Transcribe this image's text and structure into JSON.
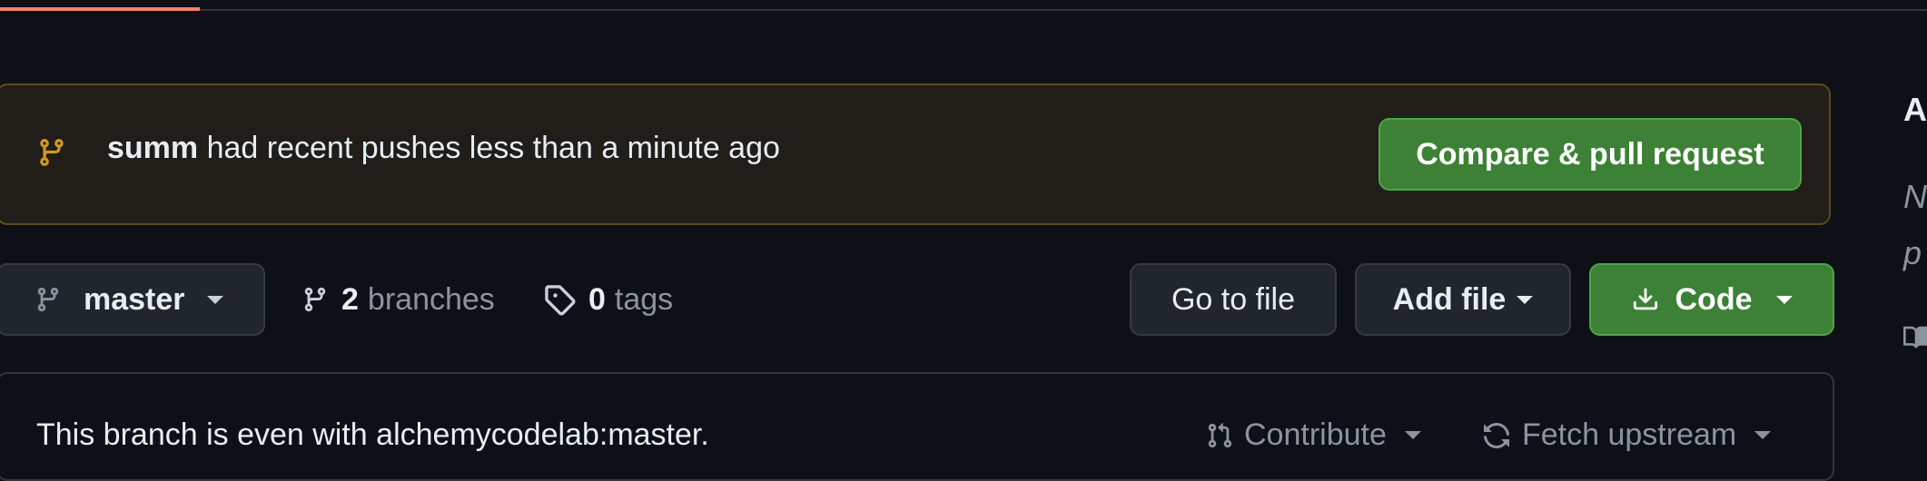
{
  "banner": {
    "branch_name": "summ",
    "message": "had recent pushes less than a minute ago",
    "compare_button": "Compare & pull request"
  },
  "toolbar": {
    "branch_selector": "master",
    "branches_count": "2",
    "branches_label": "branches",
    "tags_count": "0",
    "tags_label": "tags",
    "go_to_file": "Go to file",
    "add_file": "Add file",
    "code": "Code"
  },
  "status": {
    "message": "This branch is even with alchemycodelab:master.",
    "contribute": "Contribute",
    "fetch_upstream": "Fetch upstream"
  },
  "sidebar": {
    "heading_partial": "A",
    "line1_partial": "N",
    "line2_partial": "p"
  },
  "colors": {
    "background": "#0d1117",
    "primary_green": "#3c8135",
    "banner_bg": "#211e19",
    "tab_underline": "#f78166",
    "muted_text": "#8b949e"
  },
  "icons": {
    "banner": "git-branch-icon",
    "branch_selector": "git-branch-icon",
    "branches": "git-branch-icon",
    "tags": "tag-icon",
    "code": "download-icon",
    "contribute": "pull-request-icon",
    "fetch": "sync-icon",
    "sidebar": "book-icon"
  }
}
